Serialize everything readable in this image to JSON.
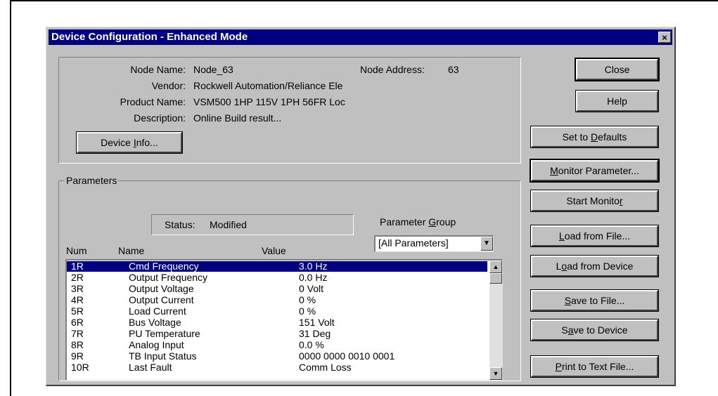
{
  "window": {
    "title": "Device Configuration - Enhanced Mode",
    "close_glyph": "×"
  },
  "device": {
    "node_name_label": "Node Name:",
    "node_name": "Node_63",
    "node_address_label": "Node Address:",
    "node_address": "63",
    "vendor_label": "Vendor:",
    "vendor": "Rockwell Automation/Reliance Ele",
    "product_name_label": "Product Name:",
    "product_name": "VSM500 1HP 115V 1PH  56FR Loc",
    "description_label": "Description:",
    "description": "Online Build result...",
    "info_button_pre": "Device ",
    "info_button_mn": "I",
    "info_button_post": "nfo..."
  },
  "parameters": {
    "group_title": "Parameters",
    "status_label": "Status:",
    "status": "Modified",
    "group_label_pre": "Parameter ",
    "group_label_mn": "G",
    "group_label_post": "roup",
    "group_selected": "[All Parameters]",
    "columns": {
      "num": "Num",
      "name": "Name",
      "value": "Value"
    },
    "rows": [
      {
        "num": "1R",
        "name": "Cmd Frequency",
        "value": "3.0 Hz"
      },
      {
        "num": "2R",
        "name": "Output Frequency",
        "value": "0.0 Hz"
      },
      {
        "num": "3R",
        "name": "Output Voltage",
        "value": "0 Volt"
      },
      {
        "num": "4R",
        "name": "Output Current",
        "value": "0 %"
      },
      {
        "num": "5R",
        "name": "Load Current",
        "value": "0 %"
      },
      {
        "num": "6R",
        "name": "Bus Voltage",
        "value": "151 Volt"
      },
      {
        "num": "7R",
        "name": "PU Temperature",
        "value": "31 Deg"
      },
      {
        "num": "8R",
        "name": "Analog Input",
        "value": "0.0 %"
      },
      {
        "num": "9R",
        "name": "TB Input Status",
        "value": "0000 0000 0010 0001"
      },
      {
        "num": "10R",
        "name": "Last Fault",
        "value": "Comm Loss"
      }
    ],
    "selected_index": 0
  },
  "buttons": {
    "close": {
      "pre": "Close",
      "mn": "",
      "post": ""
    },
    "help": {
      "pre": "Help",
      "mn": "",
      "post": ""
    },
    "defaults": {
      "pre": "Set to ",
      "mn": "D",
      "post": "efaults"
    },
    "monitor_param": {
      "pre": "",
      "mn": "M",
      "post": "onitor Parameter..."
    },
    "start_monitor": {
      "pre": "Start Monito",
      "mn": "r",
      "post": ""
    },
    "load_file": {
      "pre": "",
      "mn": "L",
      "post": "oad from File..."
    },
    "load_device": {
      "pre": "L",
      "mn": "o",
      "post": "ad from Device"
    },
    "save_file": {
      "pre": "",
      "mn": "S",
      "post": "ave to File..."
    },
    "save_device": {
      "pre": "S",
      "mn": "a",
      "post": "ve to Device"
    },
    "print_file": {
      "pre": "",
      "mn": "P",
      "post": "rint to Text File..."
    }
  },
  "icons": {
    "scroll_up": "up-arrow",
    "scroll_down": "down-arrow",
    "dropdown": "down-arrow"
  },
  "colors": {
    "titlebar": "#000080",
    "dialog_bg": "#c0c0c0",
    "selection": "#000080"
  }
}
